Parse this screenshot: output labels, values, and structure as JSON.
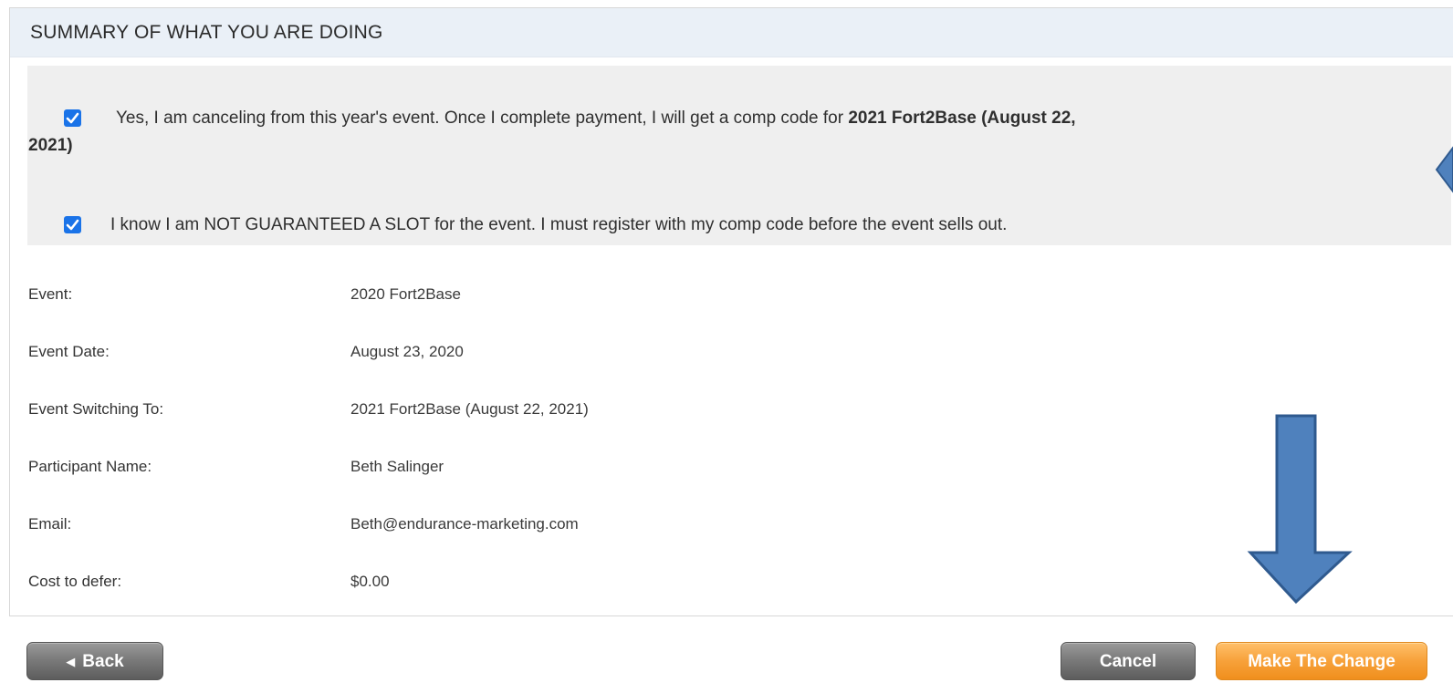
{
  "summary": {
    "title": "SUMMARY OF WHAT YOU ARE DOING"
  },
  "acknowledgements": {
    "cancel_line_1": "Yes, I am canceling from this year's event. Once I complete payment, I will get a comp code for",
    "cancel_line_1_bold": "2021 Fort2Base (August 22,",
    "cancel_line_2_bold": "2021)",
    "not_guaranteed_prefix": "I know I am NOT GUARANTEED A SLOT for the event. I must register with my comp code before the event sells out."
  },
  "details": {
    "event_label": "Event:",
    "event_value": "2020 Fort2Base",
    "event_date_label": "Event Date:",
    "event_date_value": "August 23, 2020",
    "switching_label": "Event Switching To:",
    "switching_value": "2021 Fort2Base (August 22, 2021)",
    "participant_label": "Participant Name:",
    "participant_value": "Beth Salinger",
    "email_label": "Email:",
    "email_value": "Beth@endurance-marketing.com",
    "cost_label": "Cost to defer:",
    "cost_value": "$0.00"
  },
  "buttons": {
    "back_label": "Back",
    "cancel_label": "Cancel",
    "make_change_label": "Make The Change"
  },
  "colors": {
    "checkbox": "#1a73e8",
    "overlay_arrow": "#4f81bd",
    "primary_button": "#f7a13a"
  },
  "icons": {
    "checkbox": "check-icon",
    "back": "triangle-left-icon",
    "overlay": "down-arrow-icon"
  }
}
